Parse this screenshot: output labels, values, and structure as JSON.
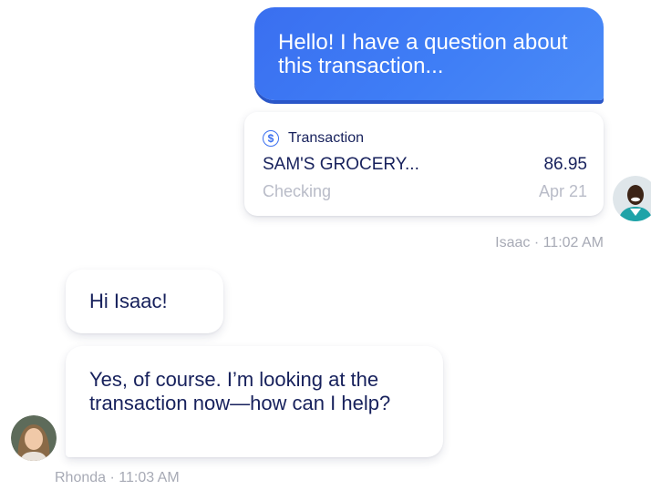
{
  "chat": {
    "outgoing_message": "Hello! I have a question about this transaction...",
    "transaction": {
      "header": "Transaction",
      "merchant": "SAM'S GROCERY...",
      "amount": "86.95",
      "account": "Checking",
      "date": "Apr 21",
      "icon": "dollar-circle-icon"
    },
    "outgoing_meta": "Isaac · 11:02 AM",
    "incoming_messages": [
      "Hi Isaac!",
      "Yes, of course. I’m looking at the transaction now—how can I help?"
    ],
    "incoming_meta": "Rhonda · 11:03 AM"
  },
  "colors": {
    "accent": "#3a6ff0",
    "text_dark": "#17215c",
    "text_muted": "#a7aab5"
  }
}
